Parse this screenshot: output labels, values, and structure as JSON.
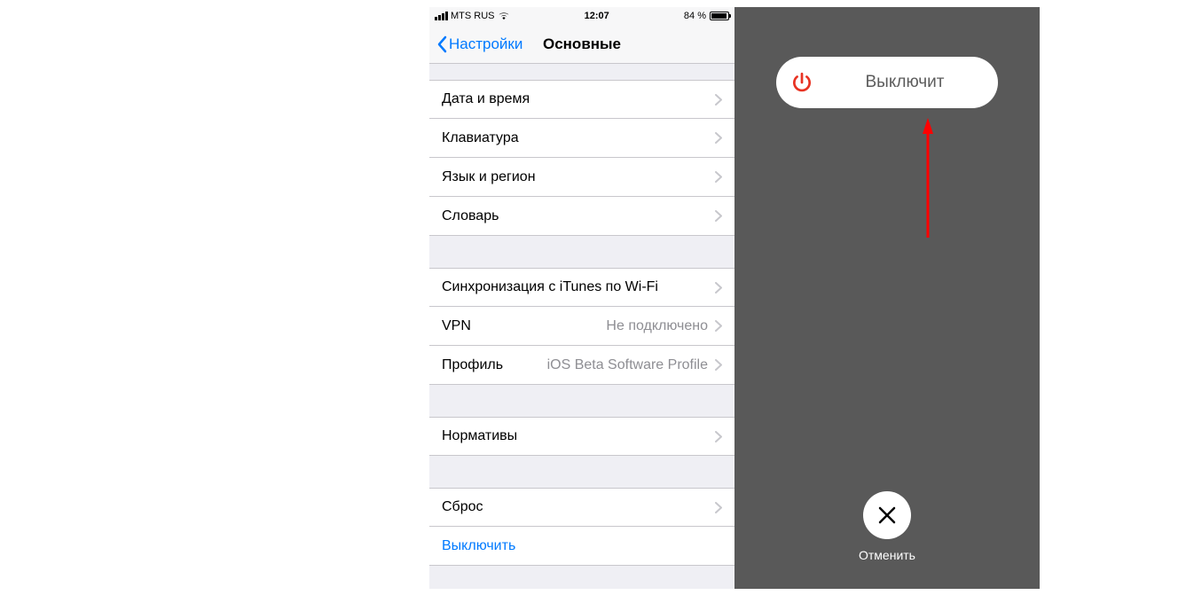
{
  "status_bar": {
    "carrier": "MTS RUS",
    "time": "12:07",
    "battery_pct": "84 %"
  },
  "nav": {
    "back_label": "Настройки",
    "title": "Основные"
  },
  "groups": {
    "g1": [
      {
        "label": "Дата и время"
      },
      {
        "label": "Клавиатура"
      },
      {
        "label": "Язык и регион"
      },
      {
        "label": "Словарь"
      }
    ],
    "g2": [
      {
        "label": "Синхронизация с iTunes по Wi-Fi"
      },
      {
        "label": "VPN",
        "detail": "Не подключено"
      },
      {
        "label": "Профиль",
        "detail": "iOS Beta Software Profile"
      }
    ],
    "g3": [
      {
        "label": "Нормативы"
      }
    ],
    "g4": [
      {
        "label": "Сброс"
      },
      {
        "label": "Выключить",
        "link": true
      }
    ]
  },
  "poweroff": {
    "slide_text": "Выключит",
    "cancel_label": "Отменить"
  },
  "colors": {
    "ios_blue": "#007AFF",
    "power_red": "#E83323",
    "bg_gray": "#EFEFF4",
    "dim_bg": "#595959"
  }
}
